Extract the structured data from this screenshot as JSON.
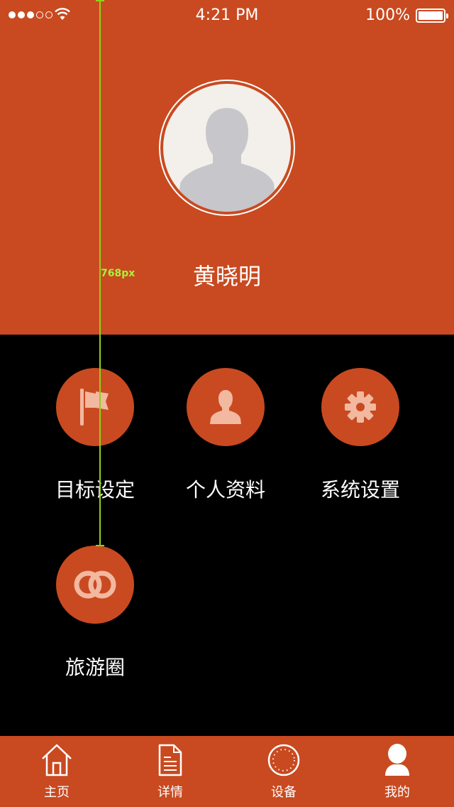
{
  "status_bar": {
    "time": "4:21 PM",
    "battery": "100%",
    "signal_icon": "signal-dots-icon",
    "wifi_icon": "wifi-icon",
    "battery_icon": "battery-icon"
  },
  "profile": {
    "name": "黄晓明",
    "avatar_icon": "user-silhouette-icon"
  },
  "guide": {
    "label": "768px"
  },
  "menu": {
    "items": [
      {
        "label": "目标设定",
        "icon": "flag-icon"
      },
      {
        "label": "个人资料",
        "icon": "person-icon"
      },
      {
        "label": "系统设置",
        "icon": "gear-icon"
      },
      {
        "label": "旅游圈",
        "icon": "linked-rings-icon"
      }
    ]
  },
  "tabs": [
    {
      "label": "主页",
      "icon": "home-icon"
    },
    {
      "label": "详情",
      "icon": "document-icon"
    },
    {
      "label": "设备",
      "icon": "device-circle-icon"
    },
    {
      "label": "我的",
      "icon": "profile-icon",
      "active": true
    }
  ],
  "colors": {
    "brand": "#c94a20",
    "background": "#000000",
    "icon_light": "#f2b8a0",
    "guide": "#8fd11a"
  }
}
